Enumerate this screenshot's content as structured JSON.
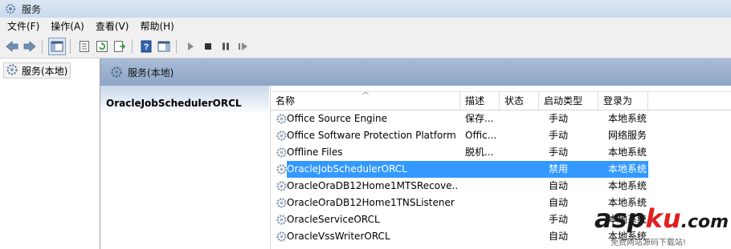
{
  "window": {
    "title": "服务"
  },
  "menu": [
    "文件(F)",
    "操作(A)",
    "查看(V)",
    "帮助(H)"
  ],
  "toolbar": {
    "icons": [
      "back-arrow-icon",
      "forward-arrow-icon",
      "show-hide-tree-icon",
      "properties-icon",
      "refresh-icon",
      "export-list-icon",
      "help-icon",
      "show-hide-action-icon",
      "start-service-icon",
      "stop-service-icon",
      "pause-service-icon",
      "restart-service-icon"
    ]
  },
  "tree": {
    "root_label": "服务(本地)"
  },
  "main": {
    "header_title": "服务(本地)",
    "selected_service_name": "OracleJobSchedulerORCL"
  },
  "list": {
    "columns": [
      "名称",
      "描述",
      "状态",
      "启动类型",
      "登录为"
    ],
    "rows": [
      {
        "name": "Office  Source Engine",
        "desc": "保存...",
        "status": "",
        "startup": "手动",
        "logon": "本地系统"
      },
      {
        "name": "Office Software Protection Platform",
        "desc": "Offic...",
        "status": "",
        "startup": "手动",
        "logon": "网络服务"
      },
      {
        "name": "Offline Files",
        "desc": "脱机...",
        "status": "",
        "startup": "手动",
        "logon": "本地系统"
      },
      {
        "name": "OracleJobSchedulerORCL",
        "desc": "",
        "status": "",
        "startup": "禁用",
        "logon": "本地系统",
        "selected": true
      },
      {
        "name": "OracleOraDB12Home1MTSRecove...",
        "desc": "",
        "status": "",
        "startup": "自动",
        "logon": "本地系统"
      },
      {
        "name": "OracleOraDB12Home1TNSListener",
        "desc": "",
        "status": "",
        "startup": "自动",
        "logon": "本地系统"
      },
      {
        "name": "OracleServiceORCL",
        "desc": "",
        "status": "",
        "startup": "手动",
        "logon": "本地系统"
      },
      {
        "name": "OracleVssWriterORCL",
        "desc": "",
        "status": "",
        "startup": "自动",
        "logon": "本地系统"
      }
    ]
  },
  "watermark": {
    "brand_a": "asp",
    "brand_b": "ku",
    "brand_c": ".com",
    "tagline": "免费网站源码下载站!"
  },
  "colors": {
    "selection": "#3399ff",
    "header_gradient_top": "#a9bcd6",
    "watermark_red": "#e02020"
  }
}
